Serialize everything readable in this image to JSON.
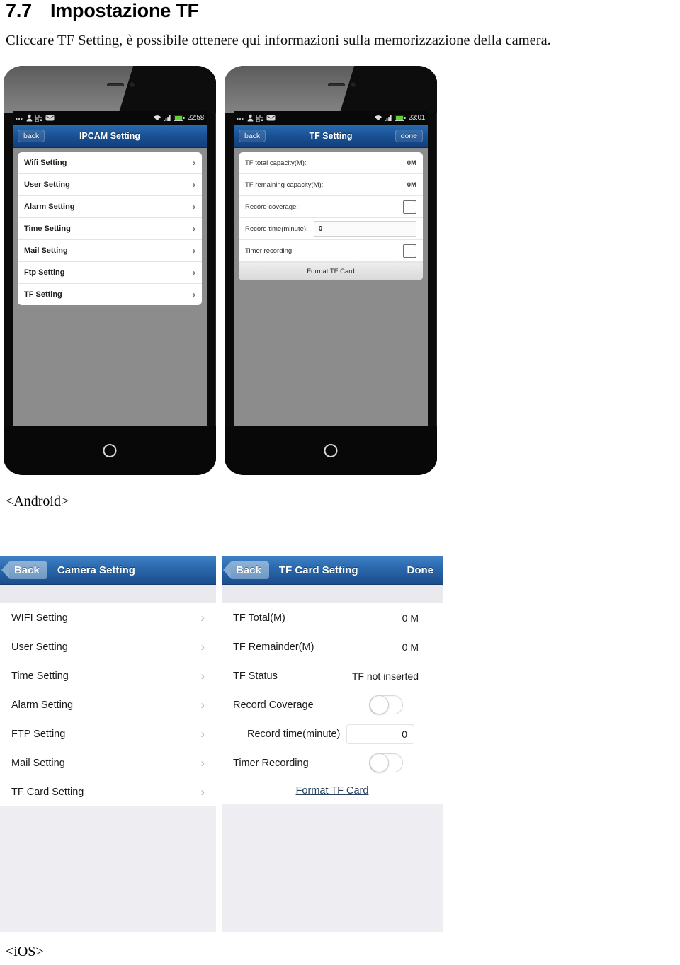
{
  "document": {
    "section_number": "7.7",
    "section_title": "Impostazione TF",
    "paragraph": "Cliccare TF Setting, è possibile ottenere qui informazioni sulla memorizzazione della camera.",
    "caption_android": "<Android>",
    "caption_ios": "<iOS>"
  },
  "colors": {
    "android_header_blue": "#1b5396",
    "ios_header_blue": "#2a68ad",
    "ios_panel_bg": "#eeeef2",
    "android_screen_bg": "#8c8c8c",
    "ios_link": "#26405e"
  },
  "android": {
    "left_phone": {
      "statusbar": {
        "time": "22:58",
        "left_icons": [
          "more-dots-icon",
          "person-icon",
          "qr-icon",
          "mail-icon"
        ],
        "right_icons": [
          "wifi-icon",
          "signal-icon",
          "battery-icon"
        ]
      },
      "titlebar": {
        "back_label": "back",
        "title": "IPCAM  Setting"
      },
      "rows": [
        {
          "label": "Wifi Setting"
        },
        {
          "label": "User Setting"
        },
        {
          "label": "Alarm Setting"
        },
        {
          "label": "Time Setting"
        },
        {
          "label": "Mail Setting"
        },
        {
          "label": "Ftp Setting"
        },
        {
          "label": "TF Setting"
        }
      ]
    },
    "right_phone": {
      "statusbar": {
        "time": "23:01",
        "left_icons": [
          "more-dots-icon",
          "person-icon",
          "qr-icon",
          "mail-icon"
        ],
        "right_icons": [
          "wifi-icon",
          "signal-icon",
          "battery-icon"
        ]
      },
      "titlebar": {
        "back_label": "back",
        "title": "TF Setting",
        "done_label": "done"
      },
      "rows": [
        {
          "type": "value",
          "label": "TF total capacity(M):",
          "value": "0M"
        },
        {
          "type": "value",
          "label": "TF remaining capacity(M):",
          "value": "0M"
        },
        {
          "type": "checkbox",
          "label": "Record coverage:",
          "checked": false
        },
        {
          "type": "input",
          "label": "Record time(minute):",
          "value": "0"
        },
        {
          "type": "checkbox",
          "label": "Timer recording:",
          "checked": false
        }
      ],
      "format_button": "Format TF Card"
    }
  },
  "ios": {
    "left_panel": {
      "navbar": {
        "back_label": "Back",
        "title": "Camera Setting"
      },
      "rows": [
        {
          "label": "WIFI Setting"
        },
        {
          "label": "User Setting"
        },
        {
          "label": "Time Setting"
        },
        {
          "label": "Alarm Setting"
        },
        {
          "label": "FTP Setting"
        },
        {
          "label": "Mail Setting"
        },
        {
          "label": "TF Card Setting"
        }
      ]
    },
    "right_panel": {
      "navbar": {
        "back_label": "Back",
        "title": "TF Card Setting",
        "done_label": "Done"
      },
      "rows": [
        {
          "type": "value",
          "label": "TF Total(M)",
          "value": "0 M"
        },
        {
          "type": "value",
          "label": "TF Remainder(M)",
          "value": "0 M"
        },
        {
          "type": "value",
          "label": "TF Status",
          "value": "TF not inserted"
        },
        {
          "type": "toggle",
          "label": "Record Coverage",
          "on": false
        },
        {
          "type": "input",
          "label": "Record time(minute)",
          "value": "0"
        },
        {
          "type": "toggle",
          "label": "Timer Recording",
          "on": false
        }
      ],
      "format_link": "Format TF Card"
    }
  }
}
